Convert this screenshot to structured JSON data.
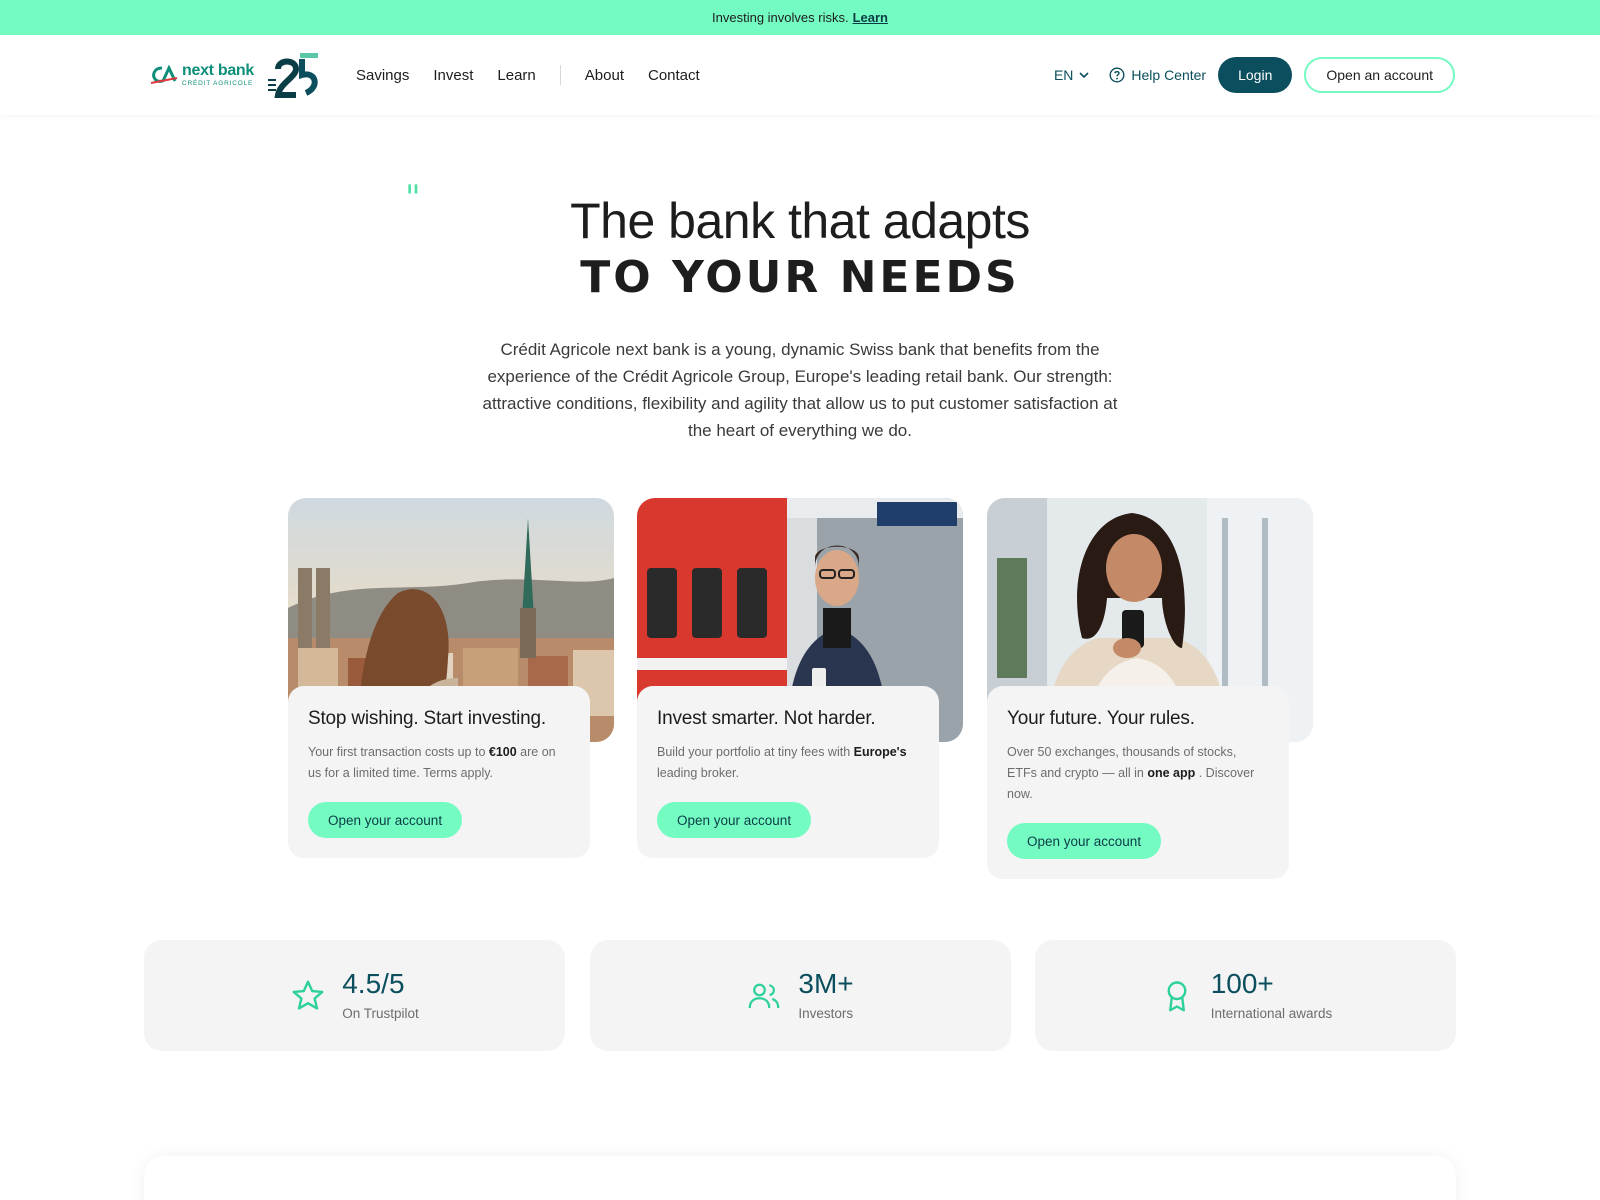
{
  "banner": {
    "text": "Investing involves risks.",
    "link": "Learn"
  },
  "brand": {
    "name": "next bank",
    "sub": "CRÉDIT AGRICOLE",
    "mark": "CA",
    "badge": "25"
  },
  "nav": {
    "left": [
      "Savings",
      "Invest",
      "Learn"
    ],
    "right": [
      "About",
      "Contact"
    ]
  },
  "header": {
    "language": "EN",
    "help": "Help Center",
    "login": "Login",
    "open_account": "Open an account"
  },
  "hero": {
    "title": "The bank that adapts",
    "subtitle": "TO YOUR NEEDS",
    "intro": "Crédit Agricole next bank is a young, dynamic Swiss bank that benefits from the experience of the Crédit Agricole Group, Europe's leading retail bank. Our strength: attractive conditions, flexibility and agility that allow us to put customer satisfaction at the heart of everything we do."
  },
  "cards": [
    {
      "title": "Stop wishing. Start investing.",
      "text_before": "Your first transaction costs up to ",
      "bold": "€100",
      "text_after": " are on us for a limited time. Terms apply.",
      "cta": "Open your account"
    },
    {
      "title": "Invest smarter. Not harder.",
      "text_before": "Build your portfolio at tiny fees with ",
      "bold": "Europe's",
      "text_after": " leading broker.",
      "cta": "Open your account"
    },
    {
      "title": "Your future. Your rules.",
      "text_before": "Over 50 exchanges, thousands of stocks, ETFs and crypto — all in ",
      "bold": "one app",
      "text_after": " . Discover now.",
      "cta": "Open your account"
    }
  ],
  "stats": [
    {
      "value": "4.5/5",
      "label": "On Trustpilot",
      "icon": "star-icon"
    },
    {
      "value": "3M+",
      "label": "Investors",
      "icon": "users-icon"
    },
    {
      "value": "100+",
      "label": "International awards",
      "icon": "award-icon"
    }
  ],
  "colors": {
    "accent": "#74fbc2",
    "primary": "#0b4f5e",
    "brand_green": "#0f8f7a",
    "card_bg": "#f4f4f4"
  }
}
